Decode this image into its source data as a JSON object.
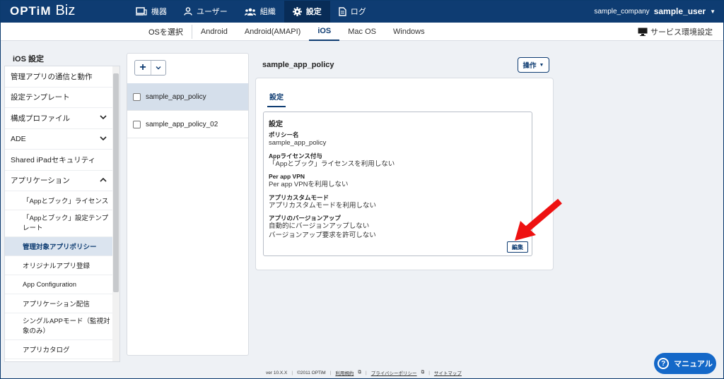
{
  "header": {
    "logo_main": "OPTiM",
    "logo_sub": "Biz",
    "nav": [
      {
        "label": "機器",
        "icon": "device-icon"
      },
      {
        "label": "ユーザー",
        "icon": "user-icon"
      },
      {
        "label": "組織",
        "icon": "organization-icon"
      },
      {
        "label": "設定",
        "icon": "gear-icon",
        "active": true
      },
      {
        "label": "ログ",
        "icon": "log-icon"
      }
    ],
    "company": "sample_company",
    "username": "sample_user"
  },
  "subnav": {
    "os_select": "OSを選択",
    "tabs": [
      "Android",
      "Android(AMAPI)",
      "iOS",
      "Mac OS",
      "Windows"
    ],
    "active_tab": "iOS",
    "service_settings": "サービス環境設定"
  },
  "sidebar": {
    "title": "iOS 設定",
    "items": [
      {
        "label": "管理アプリの通信と動作"
      },
      {
        "label": "設定テンプレート"
      },
      {
        "label": "構成プロファイル"
      },
      {
        "label": "ADE"
      },
      {
        "label": "Shared iPadセキュリティ"
      },
      {
        "label": "アプリケーション"
      },
      {
        "label": "「Appとブック」ライセンス"
      },
      {
        "label": "「Appとブック」設定テンプレート"
      },
      {
        "label": "管理対象アプリポリシー"
      },
      {
        "label": "オリジナルアプリ登録"
      },
      {
        "label": "App Configuration"
      },
      {
        "label": "アプリケーション配信"
      },
      {
        "label": "シングルAPPモード（監視対象のみ）"
      },
      {
        "label": "アプリカタログ"
      }
    ]
  },
  "policies": {
    "add_label": "+",
    "items": [
      "sample_app_policy",
      "sample_app_policy_02"
    ]
  },
  "detail": {
    "title": "sample_app_policy",
    "operation_button": "操作",
    "tab": "設定",
    "section_title": "設定",
    "fields": [
      {
        "label": "ポリシー名",
        "values": [
          "sample_app_policy"
        ]
      },
      {
        "label": "Appライセンス付与",
        "values": [
          "「Appとブック」ライセンスを利用しない"
        ]
      },
      {
        "label": "Per app VPN",
        "values": [
          "Per app VPNを利用しない"
        ]
      },
      {
        "label": "アプリカスタムモード",
        "values": [
          "アプリカスタムモードを利用しない"
        ]
      },
      {
        "label": "アプリのバージョンアップ",
        "values": [
          "自動的にバージョンアップしない",
          "バージョンアップ要求を許可しない"
        ]
      }
    ],
    "edit_button": "編集"
  },
  "footer": {
    "version": "ver 10.X.X",
    "copyright": "©2011 OPTiM",
    "links": [
      "利用規約",
      "プライバシーポリシー",
      "サイトマップ"
    ]
  },
  "manual_button": "マニュアル",
  "colors": {
    "brand": "#0e3c72",
    "manual": "#1468c8",
    "arrow": "#ee1111"
  }
}
